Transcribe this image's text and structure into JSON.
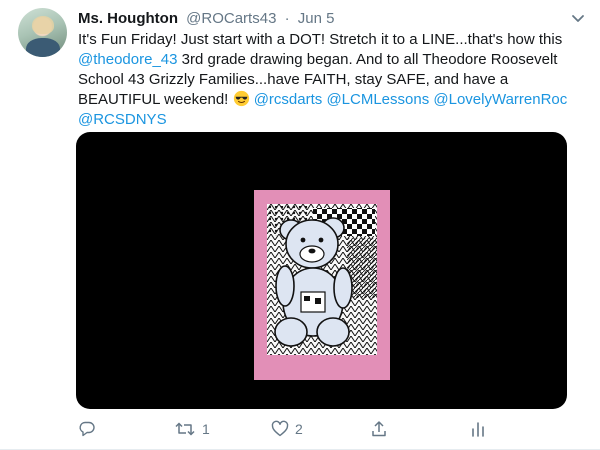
{
  "tweet": {
    "author_name": "Ms. Houghton",
    "author_handle": "@ROCarts43",
    "separator": "·",
    "date": "Jun 5",
    "text_1": "It's Fun Friday! Just start with a DOT! Stretch it to a LINE...that's how this ",
    "mention_1": "@theodore_43",
    "text_2": " 3rd grade drawing began. And to all Theodore Roosevelt School 43 Grizzly Families...have FAITH, stay SAFE, and have a BEAUTIFUL weekend! ",
    "emoji": "smiling-face-with-sunglasses",
    "mention_2": "@rcsdarts",
    "mention_3": "@LCMLessons",
    "mention_4": "@LovelyWarrenRoc",
    "mention_5": "@RCSDNYS"
  },
  "actions": {
    "reply_count": "",
    "retweet_count": "1",
    "like_count": "2",
    "share_count": "",
    "analytics_count": ""
  },
  "icons": {
    "reply": "reply-icon",
    "retweet": "retweet-icon",
    "like": "heart-icon",
    "share": "share-icon",
    "analytics": "analytics-icon",
    "menu": "chevron-down-icon"
  },
  "colors": {
    "link": "#1b95e0",
    "secondary_text": "#657786",
    "media_bg": "#000000",
    "paper": "#e28fb7"
  }
}
